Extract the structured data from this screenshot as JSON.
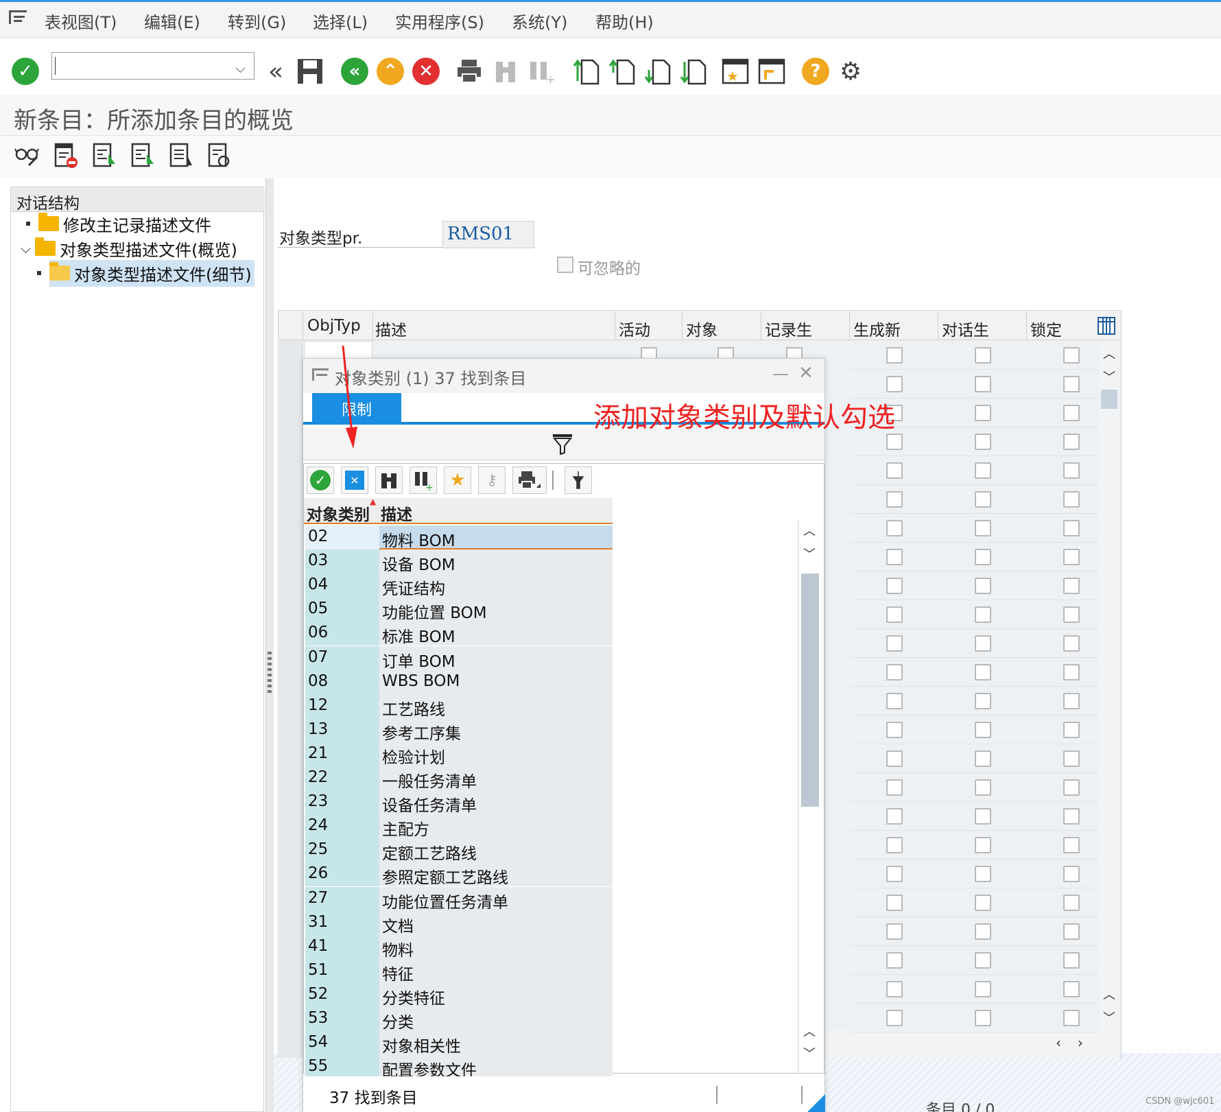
{
  "menu": {
    "items": [
      "表视图(T)",
      "编辑(E)",
      "转到(G)",
      "选择(L)",
      "实用程序(S)",
      "系统(Y)",
      "帮助(H)"
    ]
  },
  "page": {
    "title": "新条目：所添加条目的概览"
  },
  "tree": {
    "header": "对话结构",
    "items": [
      {
        "label": "修改主记录描述文件",
        "expanded": false
      },
      {
        "label": "对象类型描述文件(概览)",
        "expanded": true
      },
      {
        "label": "对象类型描述文件(细节)",
        "selected": true
      }
    ]
  },
  "form": {
    "object_type_label": "对象类型pr.",
    "object_type_value": "RMS01",
    "ignorable_label": "可忽略的"
  },
  "table": {
    "columns": [
      "ObjTyp",
      "描述",
      "活动",
      "对象",
      "记录生",
      "生成新",
      "对话生",
      "锁定"
    ]
  },
  "popup": {
    "title": "对象类别 (1)   37 找到条目",
    "tab_label": "限制",
    "list_columns": [
      "对象类别",
      "描述"
    ],
    "rows": [
      {
        "code": "02",
        "desc": "物料 BOM"
      },
      {
        "code": "03",
        "desc": "设备 BOM"
      },
      {
        "code": "04",
        "desc": "凭证结构"
      },
      {
        "code": "05",
        "desc": "功能位置 BOM"
      },
      {
        "code": "06",
        "desc": "标准 BOM"
      },
      {
        "code": "07",
        "desc": "订单 BOM"
      },
      {
        "code": "08",
        "desc": "WBS BOM"
      },
      {
        "code": "12",
        "desc": "工艺路线"
      },
      {
        "code": "13",
        "desc": "参考工序集"
      },
      {
        "code": "21",
        "desc": "检验计划"
      },
      {
        "code": "22",
        "desc": "一般任务清单"
      },
      {
        "code": "23",
        "desc": "设备任务清单"
      },
      {
        "code": "24",
        "desc": "主配方"
      },
      {
        "code": "25",
        "desc": "定额工艺路线"
      },
      {
        "code": "26",
        "desc": "参照定额工艺路线"
      },
      {
        "code": "27",
        "desc": "功能位置任务清单"
      },
      {
        "code": "31",
        "desc": "文档"
      },
      {
        "code": "41",
        "desc": "物料"
      },
      {
        "code": "51",
        "desc": "特征"
      },
      {
        "code": "52",
        "desc": "分类特征"
      },
      {
        "code": "53",
        "desc": "分类"
      },
      {
        "code": "54",
        "desc": "对象相关性"
      },
      {
        "code": "55",
        "desc": "配置参数文件"
      }
    ],
    "status": "37 找到条目"
  },
  "annotation": "添加对象类别及默认勾选",
  "bottom_status": "条目 0 / 0",
  "watermark": "CSDN @wjc601",
  "colors": {
    "accent": "#1a8ee0",
    "annotation": "#ee2222",
    "ok_green": "#2ca43a",
    "cancel_red": "#e23030",
    "nav_orange": "#f0a820"
  }
}
